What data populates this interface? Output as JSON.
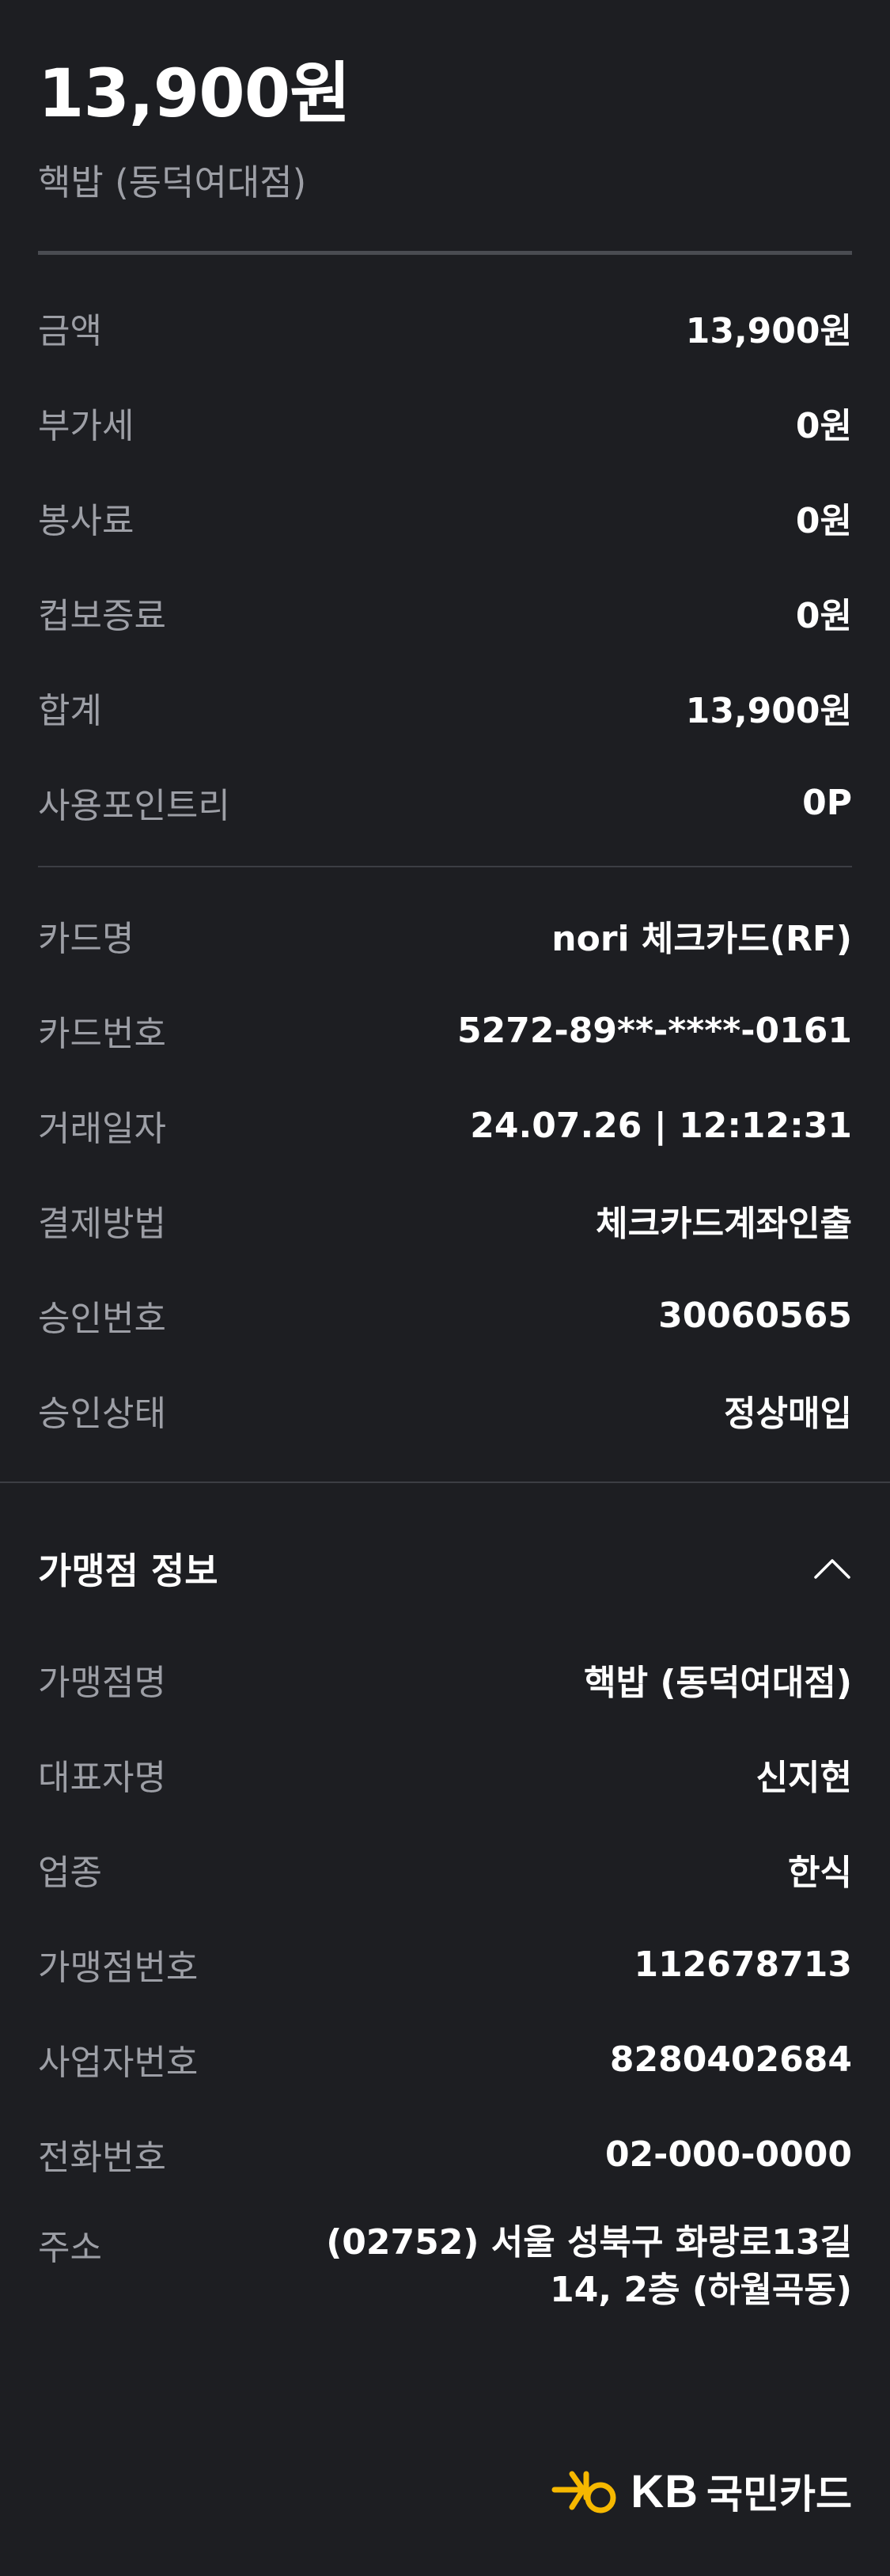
{
  "header": {
    "amount": "13,900원",
    "merchant": "핵밥 (동덕여대점)"
  },
  "amounts": [
    {
      "label": "금액",
      "value": "13,900원"
    },
    {
      "label": "부가세",
      "value": "0원"
    },
    {
      "label": "봉사료",
      "value": "0원"
    },
    {
      "label": "컵보증료",
      "value": "0원"
    },
    {
      "label": "합계",
      "value": "13,900원"
    },
    {
      "label": "사용포인트리",
      "value": "0P"
    }
  ],
  "card": [
    {
      "label": "카드명",
      "value": "nori 체크카드(RF)"
    },
    {
      "label": "카드번호",
      "value": "5272-89**-****-0161"
    },
    {
      "label": "거래일자",
      "value": "24.07.26 | 12:12:31"
    },
    {
      "label": "결제방법",
      "value": "체크카드계좌인출"
    },
    {
      "label": "승인번호",
      "value": "30060565"
    },
    {
      "label": "승인상태",
      "value": "정상매입"
    }
  ],
  "merchant_info": {
    "title": "가맹점 정보",
    "rows": [
      {
        "label": "가맹점명",
        "value": "핵밥 (동덕여대점)"
      },
      {
        "label": "대표자명",
        "value": "신지현"
      },
      {
        "label": "업종",
        "value": "한식"
      },
      {
        "label": "가맹점번호",
        "value": "112678713"
      },
      {
        "label": "사업자번호",
        "value": "8280402684"
      },
      {
        "label": "전화번호",
        "value": "02-000-0000"
      }
    ],
    "address_label": "주소",
    "address_line1": "(02752) 서울 성북구 화랑로13길",
    "address_line2": "14, 2층 (하월곡동)"
  },
  "footer": {
    "logo_kb": "KB",
    "logo_name": "국민카드",
    "logo_color": "#f6b800"
  }
}
